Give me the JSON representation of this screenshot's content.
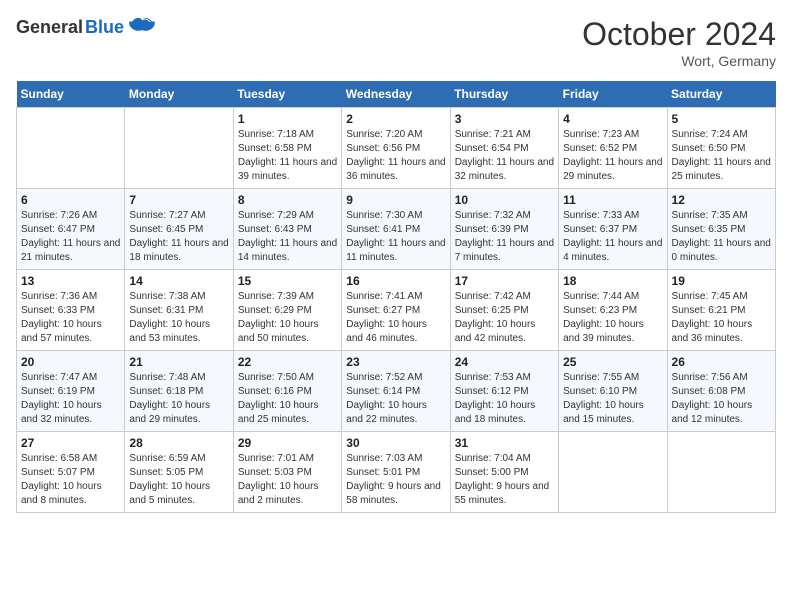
{
  "header": {
    "logo_general": "General",
    "logo_blue": "Blue",
    "month_title": "October 2024",
    "location": "Wort, Germany"
  },
  "weekdays": [
    "Sunday",
    "Monday",
    "Tuesday",
    "Wednesday",
    "Thursday",
    "Friday",
    "Saturday"
  ],
  "weeks": [
    [
      {
        "day": "",
        "info": ""
      },
      {
        "day": "",
        "info": ""
      },
      {
        "day": "1",
        "info": "Sunrise: 7:18 AM\nSunset: 6:58 PM\nDaylight: 11 hours and 39 minutes."
      },
      {
        "day": "2",
        "info": "Sunrise: 7:20 AM\nSunset: 6:56 PM\nDaylight: 11 hours and 36 minutes."
      },
      {
        "day": "3",
        "info": "Sunrise: 7:21 AM\nSunset: 6:54 PM\nDaylight: 11 hours and 32 minutes."
      },
      {
        "day": "4",
        "info": "Sunrise: 7:23 AM\nSunset: 6:52 PM\nDaylight: 11 hours and 29 minutes."
      },
      {
        "day": "5",
        "info": "Sunrise: 7:24 AM\nSunset: 6:50 PM\nDaylight: 11 hours and 25 minutes."
      }
    ],
    [
      {
        "day": "6",
        "info": "Sunrise: 7:26 AM\nSunset: 6:47 PM\nDaylight: 11 hours and 21 minutes."
      },
      {
        "day": "7",
        "info": "Sunrise: 7:27 AM\nSunset: 6:45 PM\nDaylight: 11 hours and 18 minutes."
      },
      {
        "day": "8",
        "info": "Sunrise: 7:29 AM\nSunset: 6:43 PM\nDaylight: 11 hours and 14 minutes."
      },
      {
        "day": "9",
        "info": "Sunrise: 7:30 AM\nSunset: 6:41 PM\nDaylight: 11 hours and 11 minutes."
      },
      {
        "day": "10",
        "info": "Sunrise: 7:32 AM\nSunset: 6:39 PM\nDaylight: 11 hours and 7 minutes."
      },
      {
        "day": "11",
        "info": "Sunrise: 7:33 AM\nSunset: 6:37 PM\nDaylight: 11 hours and 4 minutes."
      },
      {
        "day": "12",
        "info": "Sunrise: 7:35 AM\nSunset: 6:35 PM\nDaylight: 11 hours and 0 minutes."
      }
    ],
    [
      {
        "day": "13",
        "info": "Sunrise: 7:36 AM\nSunset: 6:33 PM\nDaylight: 10 hours and 57 minutes."
      },
      {
        "day": "14",
        "info": "Sunrise: 7:38 AM\nSunset: 6:31 PM\nDaylight: 10 hours and 53 minutes."
      },
      {
        "day": "15",
        "info": "Sunrise: 7:39 AM\nSunset: 6:29 PM\nDaylight: 10 hours and 50 minutes."
      },
      {
        "day": "16",
        "info": "Sunrise: 7:41 AM\nSunset: 6:27 PM\nDaylight: 10 hours and 46 minutes."
      },
      {
        "day": "17",
        "info": "Sunrise: 7:42 AM\nSunset: 6:25 PM\nDaylight: 10 hours and 42 minutes."
      },
      {
        "day": "18",
        "info": "Sunrise: 7:44 AM\nSunset: 6:23 PM\nDaylight: 10 hours and 39 minutes."
      },
      {
        "day": "19",
        "info": "Sunrise: 7:45 AM\nSunset: 6:21 PM\nDaylight: 10 hours and 36 minutes."
      }
    ],
    [
      {
        "day": "20",
        "info": "Sunrise: 7:47 AM\nSunset: 6:19 PM\nDaylight: 10 hours and 32 minutes."
      },
      {
        "day": "21",
        "info": "Sunrise: 7:48 AM\nSunset: 6:18 PM\nDaylight: 10 hours and 29 minutes."
      },
      {
        "day": "22",
        "info": "Sunrise: 7:50 AM\nSunset: 6:16 PM\nDaylight: 10 hours and 25 minutes."
      },
      {
        "day": "23",
        "info": "Sunrise: 7:52 AM\nSunset: 6:14 PM\nDaylight: 10 hours and 22 minutes."
      },
      {
        "day": "24",
        "info": "Sunrise: 7:53 AM\nSunset: 6:12 PM\nDaylight: 10 hours and 18 minutes."
      },
      {
        "day": "25",
        "info": "Sunrise: 7:55 AM\nSunset: 6:10 PM\nDaylight: 10 hours and 15 minutes."
      },
      {
        "day": "26",
        "info": "Sunrise: 7:56 AM\nSunset: 6:08 PM\nDaylight: 10 hours and 12 minutes."
      }
    ],
    [
      {
        "day": "27",
        "info": "Sunrise: 6:58 AM\nSunset: 5:07 PM\nDaylight: 10 hours and 8 minutes."
      },
      {
        "day": "28",
        "info": "Sunrise: 6:59 AM\nSunset: 5:05 PM\nDaylight: 10 hours and 5 minutes."
      },
      {
        "day": "29",
        "info": "Sunrise: 7:01 AM\nSunset: 5:03 PM\nDaylight: 10 hours and 2 minutes."
      },
      {
        "day": "30",
        "info": "Sunrise: 7:03 AM\nSunset: 5:01 PM\nDaylight: 9 hours and 58 minutes."
      },
      {
        "day": "31",
        "info": "Sunrise: 7:04 AM\nSunset: 5:00 PM\nDaylight: 9 hours and 55 minutes."
      },
      {
        "day": "",
        "info": ""
      },
      {
        "day": "",
        "info": ""
      }
    ]
  ]
}
